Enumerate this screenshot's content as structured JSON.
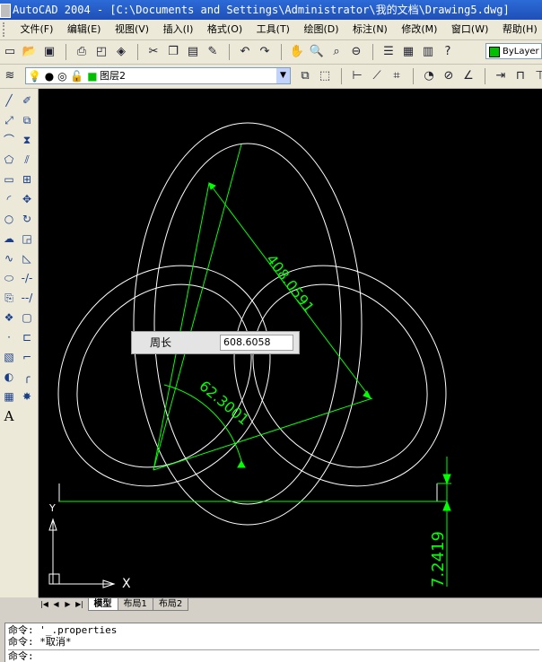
{
  "window": {
    "title": "AutoCAD 2004 - [C:\\Documents and Settings\\Administrator\\我的文档\\Drawing5.dwg]"
  },
  "menu": [
    "文件(F)",
    "编辑(E)",
    "视图(V)",
    "插入(I)",
    "格式(O)",
    "工具(T)",
    "绘图(D)",
    "标注(N)",
    "修改(M)",
    "窗口(W)",
    "帮助(H)"
  ],
  "standard_toolbar": {
    "icons": [
      "new-icon",
      "open-icon",
      "save-icon",
      "print-icon",
      "preview-icon",
      "publish-icon",
      "cut-icon",
      "copy-icon",
      "paste-icon",
      "match-icon",
      "undo-icon",
      "redo-icon",
      "pan-icon",
      "zoom-realtime-icon",
      "zoom-window-icon",
      "zoom-previous-icon",
      "properties-icon",
      "designcenter-icon",
      "toolpalette-icon",
      "help-icon"
    ],
    "color_control": "ByLayer",
    "color_swatch": "#00c000"
  },
  "layers_toolbar": {
    "current_layer": "图层2",
    "layer_state_icons": [
      "bulb-icon",
      "sun-icon",
      "freeze-icon",
      "lock-icon",
      "color-swatch-icon"
    ]
  },
  "dimension_toolbar": {
    "icons": [
      "linear-dim-icon",
      "aligned-dim-icon",
      "ordinate-dim-icon",
      "radius-dim-icon",
      "diameter-dim-icon",
      "angular-dim-icon",
      "quick-dim-icon",
      "baseline-dim-icon"
    ]
  },
  "draw_toolbar": {
    "icons": [
      "line-icon",
      "xline-icon",
      "polyline-icon",
      "polygon-icon",
      "rectangle-icon",
      "arc-icon",
      "circle-icon",
      "revcloud-icon",
      "spline-icon",
      "ellipse-icon",
      "insert-block-icon",
      "make-block-icon",
      "point-icon",
      "hatch-icon",
      "region-icon",
      "table-icon",
      "mtext-icon"
    ],
    "mtext_label": "A"
  },
  "modify_toolbar": {
    "icons": [
      "erase-icon",
      "copy-object-icon",
      "mirror-icon",
      "offset-icon",
      "array-icon",
      "move-icon",
      "rotate-icon",
      "scale-icon",
      "stretch-icon",
      "trim-icon",
      "extend-icon",
      "break-at-point-icon",
      "break-icon",
      "chamfer-icon",
      "fillet-icon",
      "explode-icon"
    ]
  },
  "drawing": {
    "dimension_aligned": "408.0591",
    "dimension_angular": "62.3001",
    "dimension_linear": "7.2419",
    "tooltip_label": "周长",
    "tooltip_value": "608.6058",
    "ucs_x": "X",
    "ucs_y": "Y",
    "line_color": "#ffffff",
    "dimension_color": "#00ff00"
  },
  "tabs": [
    "模型",
    "布局1",
    "布局2"
  ],
  "active_tab": "模型",
  "command_history": [
    "命令: '_.properties",
    "命令: *取消*"
  ],
  "command_prompt": "命令:"
}
